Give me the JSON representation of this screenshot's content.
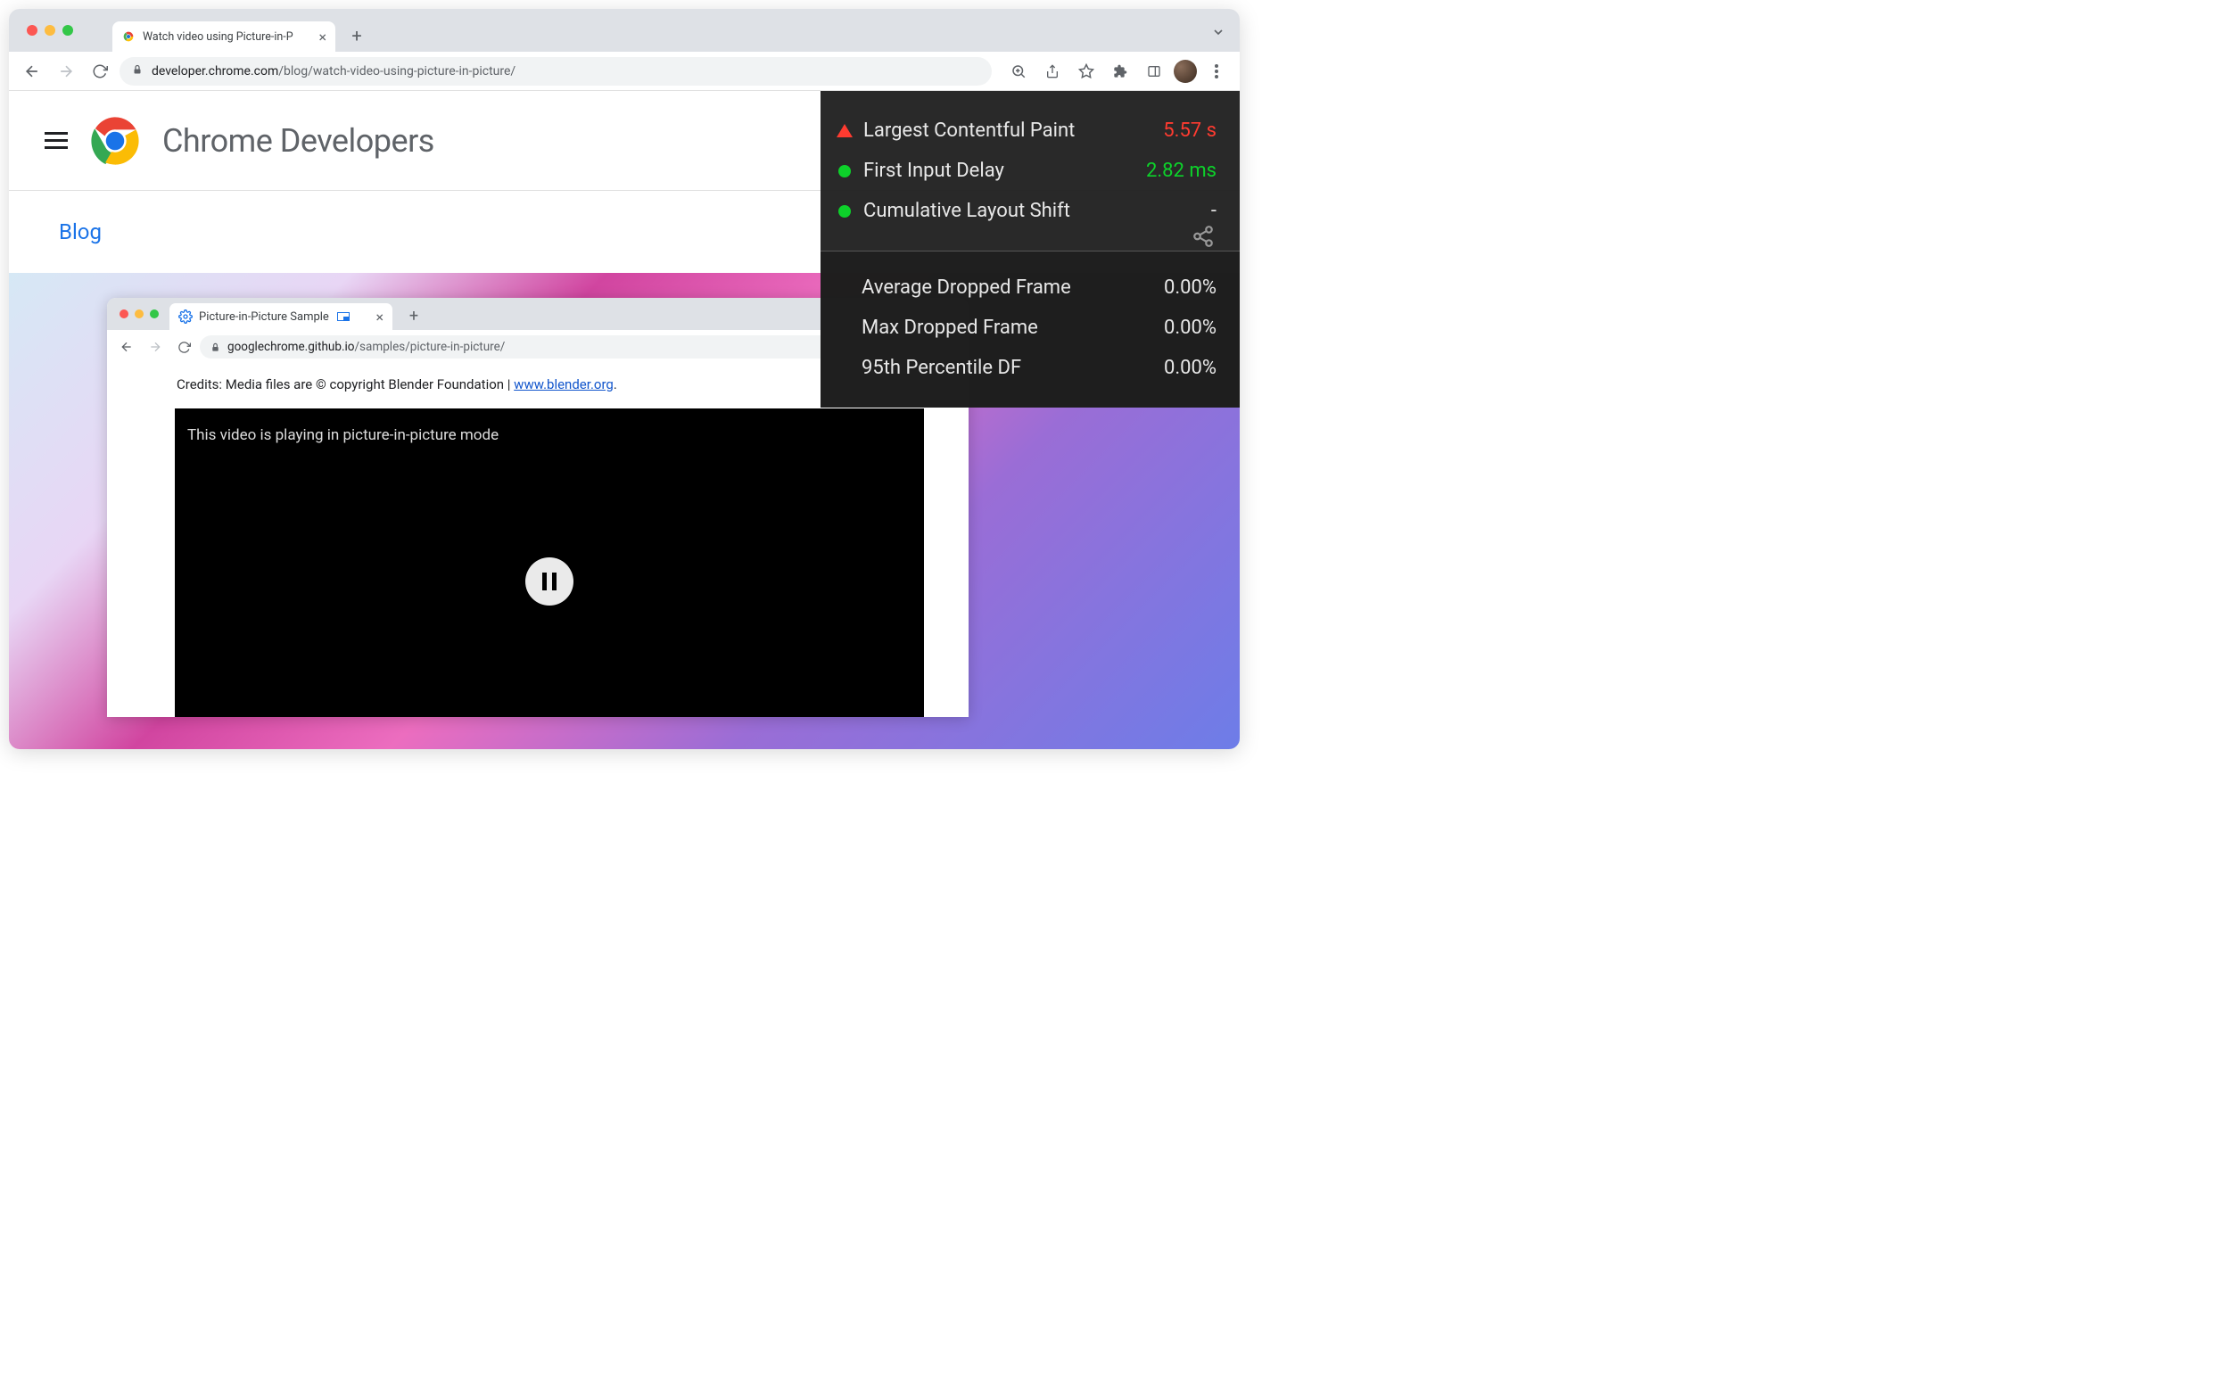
{
  "outer_tab": {
    "title": "Watch video using Picture-in-P"
  },
  "omnibox": {
    "domain": "developer.chrome.com",
    "path": "/blog/watch-video-using-picture-in-picture/"
  },
  "site": {
    "title": "Chrome Developers",
    "breadcrumb": "Blog"
  },
  "metrics": {
    "vitals": [
      {
        "indicator": "warn",
        "label": "Largest Contentful Paint",
        "value": "5.57 s",
        "color": "red"
      },
      {
        "indicator": "good",
        "label": "First Input Delay",
        "value": "2.82 ms",
        "color": "green"
      },
      {
        "indicator": "good",
        "label": "Cumulative Layout Shift",
        "value": "-",
        "color": "white"
      }
    ],
    "frames": [
      {
        "label": "Average Dropped Frame",
        "value": "0.00%"
      },
      {
        "label": "Max Dropped Frame",
        "value": "0.00%"
      },
      {
        "label": "95th Percentile DF",
        "value": "0.00%"
      }
    ]
  },
  "inner": {
    "tab_title": "Picture-in-Picture Sample",
    "url_domain": "googlechrome.github.io",
    "url_path": "/samples/picture-in-picture/",
    "credits_prefix": "Credits: Media files are © copyright Blender Foundation | ",
    "credits_link": "www.blender.org",
    "credits_suffix": ".",
    "video_msg": "This video is playing in picture-in-picture mode"
  }
}
